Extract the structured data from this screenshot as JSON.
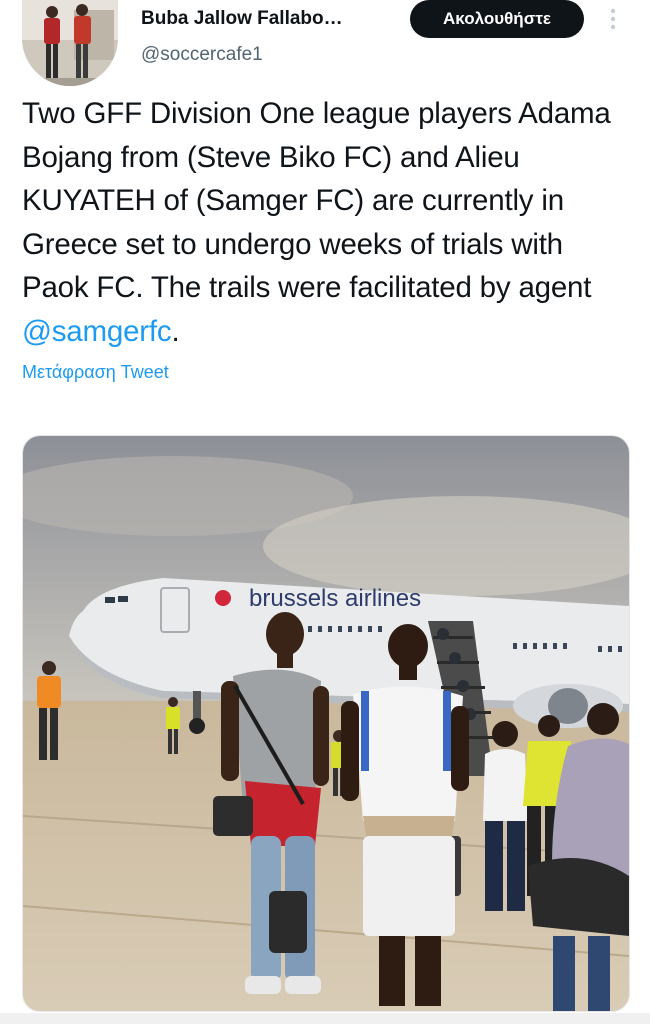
{
  "user": {
    "display_name": "Buba Jallow Fallabo…",
    "handle": "@soccercafe1"
  },
  "actions": {
    "follow_label": "Ακολουθήστε",
    "more_icon": "more-vertical-icon"
  },
  "tweet": {
    "text_before": "Two GFF Division One league players Adama Bojang from (Steve Biko FC) and Alieu KUYATEH of (Samger FC) are currently in Greece set to undergo weeks of trials with Paok FC. The trails were facilitated by agent ",
    "mention": "@samgerfc",
    "text_after": ".",
    "translate_label": "Μετάφραση Tweet"
  },
  "photo": {
    "plane_livery": "brussels airlines"
  },
  "colors": {
    "link": "#1d9bf0",
    "text": "#0f1419",
    "secondary": "#536471",
    "button_bg": "#0f1419"
  }
}
